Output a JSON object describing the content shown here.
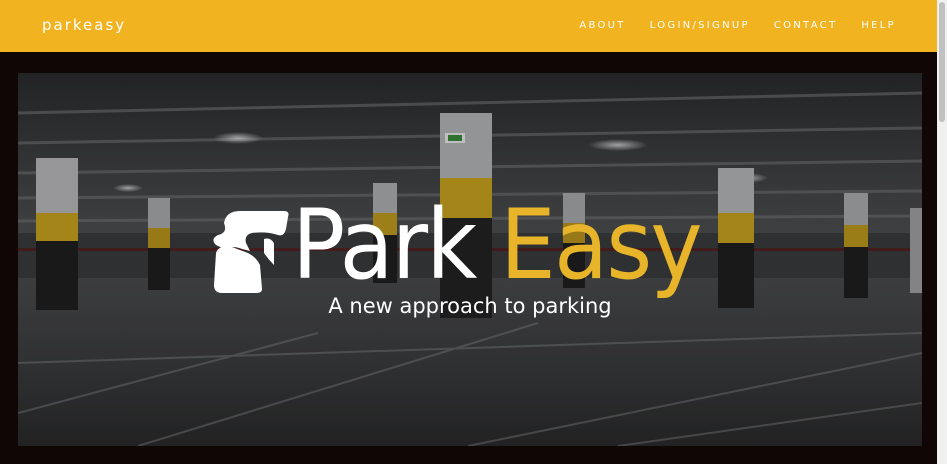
{
  "navbar": {
    "brand": "parkeasy",
    "links": [
      "ABOUT",
      "LOGIN/SIGNUP",
      "CONTACT",
      "HELP"
    ]
  },
  "hero": {
    "logo_part1": "Park",
    "logo_part2": "Easy",
    "tagline": "A new approach to parking"
  },
  "colors": {
    "navbar": "#f2b320",
    "accent": "#e8b52a",
    "page_background": "#110606"
  },
  "icons": [
    "car-logo-icon"
  ]
}
